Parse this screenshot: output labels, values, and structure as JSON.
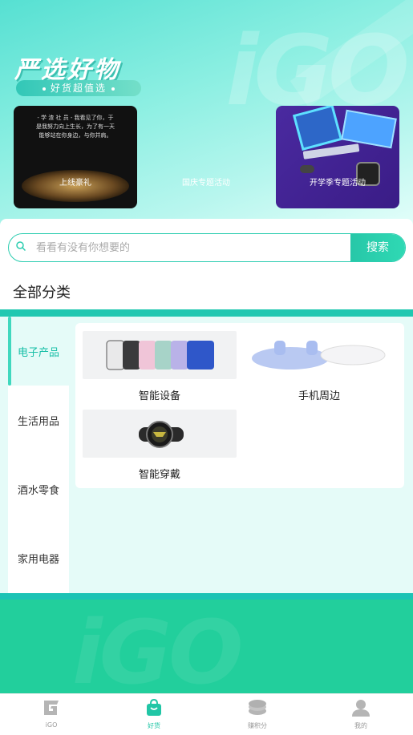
{
  "hero": {
    "slogan": "严选好物",
    "subtitle": "好货超值选"
  },
  "promos": [
    {
      "label": "上线豪礼"
    },
    {
      "label": "国庆专题活动"
    },
    {
      "label": "开学季专题活动"
    }
  ],
  "promo1_text": "- 学 渣 社 员 -  我看见了你，于是我努力向上生长，为了有一天能够站在你身边，与你并肩。",
  "search": {
    "placeholder": "看看有没有你想要的",
    "button": "搜索"
  },
  "section_title": "全部分类",
  "categories": [
    {
      "label": "电子产品",
      "active": true
    },
    {
      "label": "生活用品",
      "active": false
    },
    {
      "label": "酒水零食",
      "active": false
    },
    {
      "label": "家用电器",
      "active": false
    }
  ],
  "products": [
    {
      "name": "智能设备"
    },
    {
      "name": "手机周边"
    },
    {
      "name": "智能穿戴"
    }
  ],
  "tabs": [
    {
      "label": "iGO",
      "icon": "igo-logo-icon",
      "active": false
    },
    {
      "label": "好货",
      "icon": "shopping-bag-icon",
      "active": true
    },
    {
      "label": "赚积分",
      "icon": "coins-icon",
      "active": false
    },
    {
      "label": "我的",
      "icon": "user-icon",
      "active": false
    }
  ],
  "colors": {
    "accent": "#21c6a6",
    "teal": "#20c8b1",
    "bottom_green": "#22cf9c"
  }
}
